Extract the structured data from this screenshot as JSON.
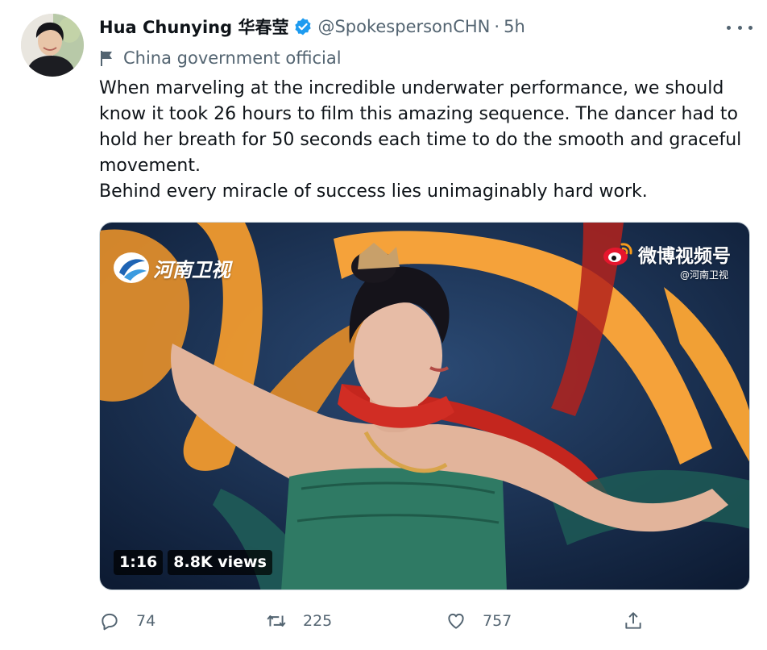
{
  "tweet": {
    "author_name": "Hua Chunying 华春莹",
    "handle": "@SpokespersonCHN",
    "separator": "·",
    "time": "5h",
    "account_label": "China government official",
    "text_lines": [
      "When marveling at the incredible underwater performance, we should know it took 26 hours to film this amazing sequence. The dancer had to hold her breath for 50 seconds each time to do the smooth and graceful movement.",
      "Behind every miracle of success lies unimaginably hard work."
    ]
  },
  "media": {
    "watermark_left": "河南卫视",
    "watermark_right": "微博视频号",
    "watermark_right_sub": "@河南卫视",
    "duration": "1:16",
    "views": "8.8K views"
  },
  "actions": {
    "replies": "74",
    "retweets": "225",
    "likes": "757"
  },
  "colors": {
    "text": "#0f1419",
    "secondary": "#536471",
    "verified": "#1d9bf0"
  },
  "icons": [
    "verified-badge-icon",
    "more-options-icon",
    "flag-icon",
    "reply-icon",
    "retweet-icon",
    "like-icon",
    "share-icon",
    "weibo-logo-icon",
    "henan-tv-logo-icon"
  ]
}
